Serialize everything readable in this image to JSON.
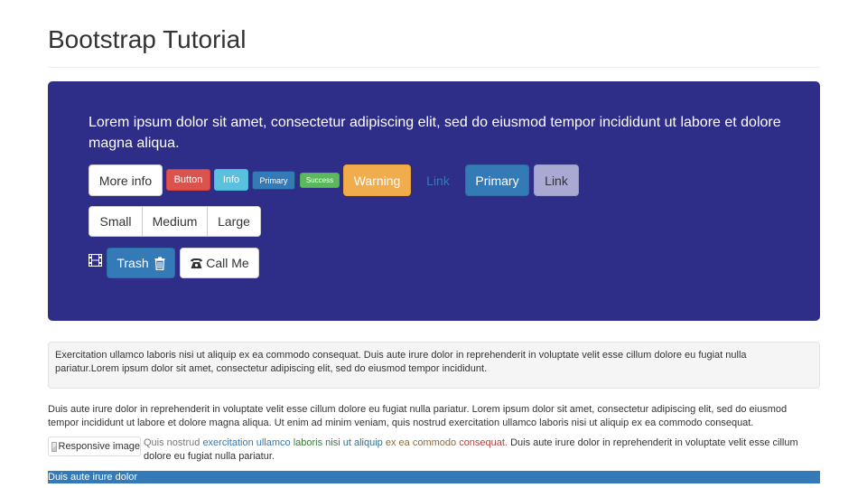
{
  "page_title": "Bootstrap Tutorial",
  "jumbotron": {
    "lead": "Lorem ipsum dolor sit amet, consectetur adipiscing elit, sed do eiusmod tempor incididunt ut labore et dolore magna aliqua.",
    "buttons": {
      "more_info": "More info",
      "button": "Button",
      "info": "Info",
      "primary_small": "Primary",
      "success": "Success",
      "warning": "Warning",
      "link": "Link",
      "primary": "Primary",
      "link_lilac": "Link"
    },
    "size_group": [
      "Small",
      "Medium",
      "Large"
    ],
    "trash_label": "Trash",
    "call_label": "Call Me"
  },
  "well_text": "Exercitation ullamco laboris nisi ut aliquip ex ea commodo consequat. Duis aute irure dolor in reprehenderit in voluptate velit esse cillum dolore eu fugiat nulla pariatur.Lorem ipsum dolor sit amet, consectetur adipiscing elit, sed do eiusmod tempor incididunt.",
  "paragraph": "Duis aute irure dolor in reprehenderit in voluptate velit esse cillum dolore eu fugiat nulla pariatur. Lorem ipsum dolor sit amet, consectetur adipiscing elit, sed do eiusmod tempor incididunt ut labore et dolore magna aliqua. Ut enim ad minim veniam, quis nostrud exercitation ullamco laboris nisi ut aliquip ex ea commodo consequat.",
  "image_alt": "Responsive image",
  "contextual": {
    "muted": "Quis nostrud",
    "primary": "exercitation ullamco",
    "success": "laboris nisi",
    "info": "ut aliquip",
    "warning": "ex ea commodo",
    "danger": "consequat.",
    "rest": "Duis aute irure dolor in reprehenderit in voluptate velit esse cillum dolore eu fugiat nulla pariatur."
  },
  "bg_primary_text": "Duis aute irure dolor",
  "icons": [
    "film-icon",
    "trash-icon",
    "phone-icon"
  ],
  "colors": {
    "jumbotron_bg": "#2e2d88",
    "primary": "#337ab7",
    "danger": "#d9534f",
    "info": "#5bc0de",
    "success": "#5cb85c",
    "warning": "#f0ad4e",
    "lilac": "#aaa9d3"
  }
}
